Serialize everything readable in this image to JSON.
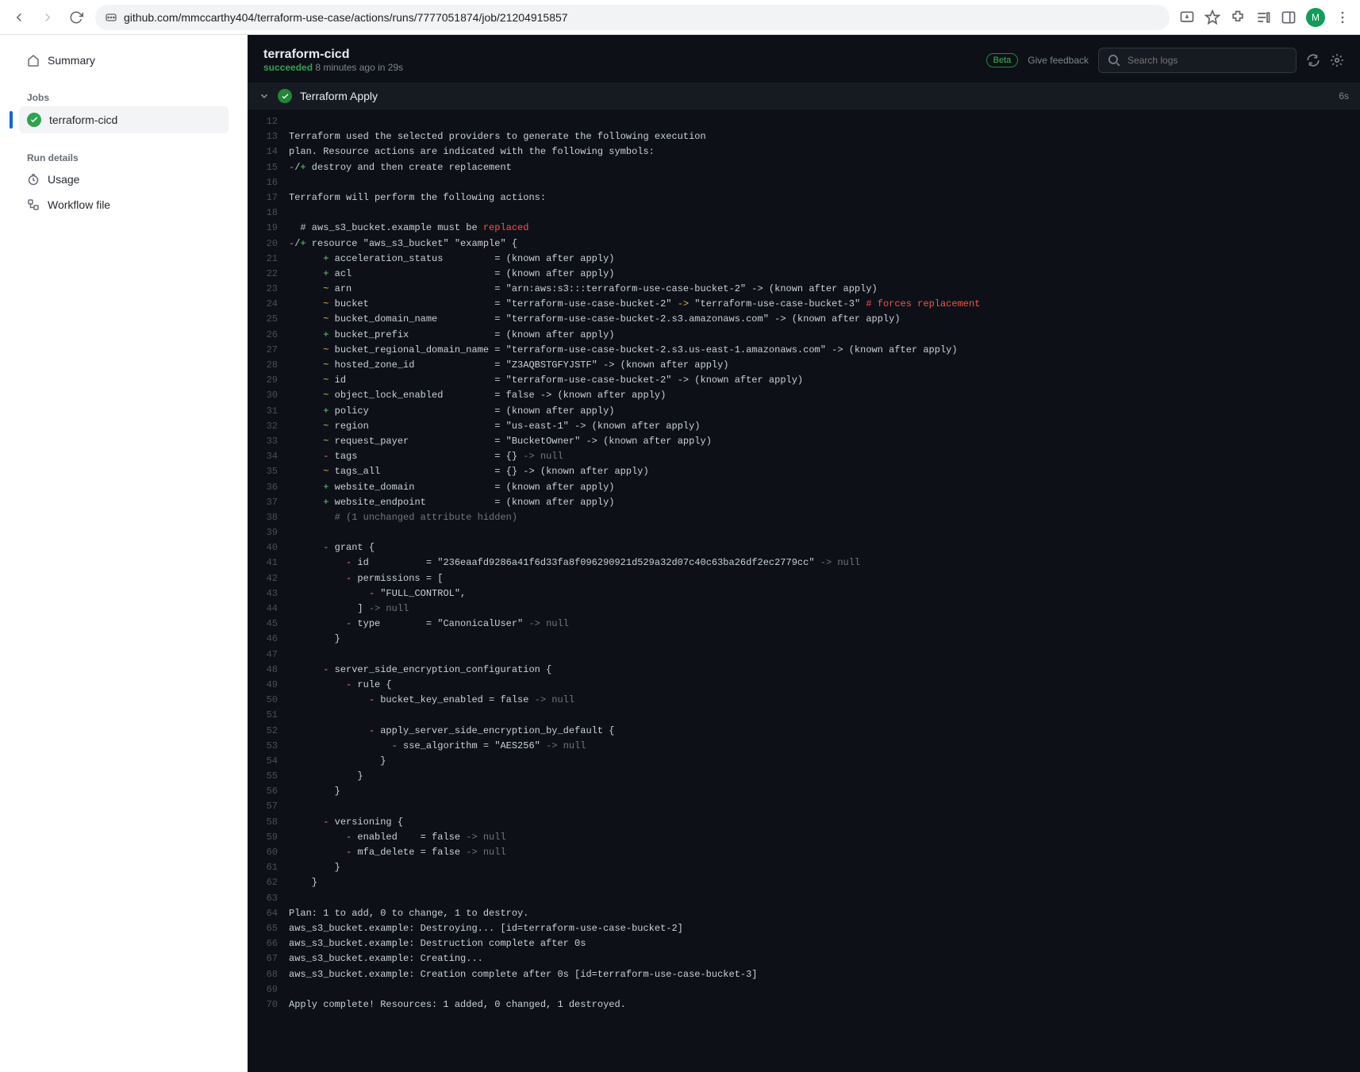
{
  "browser": {
    "url": "github.com/mmccarthy404/terraform-use-case/actions/runs/7777051874/job/21204915857",
    "avatar_letter": "M"
  },
  "sidebar": {
    "summary": "Summary",
    "jobs_heading": "Jobs",
    "job": "terraform-cicd",
    "run_details_heading": "Run details",
    "usage": "Usage",
    "workflow_file": "Workflow file"
  },
  "header": {
    "title": "terraform-cicd",
    "status": "succeeded",
    "meta_rest": " 8 minutes ago in 29s",
    "beta": "Beta",
    "feedback": "Give feedback",
    "search_placeholder": "Search logs"
  },
  "step": {
    "name": "Terraform Apply",
    "duration": "6s"
  },
  "log_lines": [
    {
      "n": 12,
      "segs": []
    },
    {
      "n": 13,
      "segs": [
        {
          "t": "Terraform used the selected providers to generate the following execution"
        }
      ]
    },
    {
      "n": 14,
      "segs": [
        {
          "t": "plan. Resource actions are indicated with the following symbols:"
        }
      ]
    },
    {
      "n": 15,
      "segs": [
        {
          "c": "c-red",
          "t": "-"
        },
        {
          "t": "/"
        },
        {
          "c": "c-green",
          "t": "+"
        },
        {
          "t": " destroy and then create replacement"
        }
      ]
    },
    {
      "n": 16,
      "segs": []
    },
    {
      "n": 17,
      "segs": [
        {
          "t": "Terraform will perform the following actions:"
        }
      ]
    },
    {
      "n": 18,
      "segs": []
    },
    {
      "n": 19,
      "segs": [
        {
          "t": "  # aws_s3_bucket.example must be "
        },
        {
          "c": "c-redcom",
          "t": "replaced"
        }
      ]
    },
    {
      "n": 20,
      "segs": [
        {
          "c": "c-red",
          "t": "-"
        },
        {
          "t": "/"
        },
        {
          "c": "c-green",
          "t": "+"
        },
        {
          "t": " resource \"aws_s3_bucket\" \"example\" {"
        }
      ]
    },
    {
      "n": 21,
      "segs": [
        {
          "t": "      "
        },
        {
          "c": "c-green",
          "t": "+"
        },
        {
          "t": " acceleration_status         = (known after apply)"
        }
      ]
    },
    {
      "n": 22,
      "segs": [
        {
          "t": "      "
        },
        {
          "c": "c-green",
          "t": "+"
        },
        {
          "t": " acl                         = (known after apply)"
        }
      ]
    },
    {
      "n": 23,
      "segs": [
        {
          "t": "      "
        },
        {
          "c": "c-orange",
          "t": "~"
        },
        {
          "t": " arn                         = \"arn:aws:s3:::terraform-use-case-bucket-2\" -> (known after apply)"
        }
      ]
    },
    {
      "n": 24,
      "segs": [
        {
          "t": "      "
        },
        {
          "c": "c-orange",
          "t": "~"
        },
        {
          "t": " bucket                      = \"terraform-use-case-bucket-2\" "
        },
        {
          "c": "c-orange",
          "t": "->"
        },
        {
          "t": " \"terraform-use-case-bucket-3\" "
        },
        {
          "c": "c-redcom",
          "t": "# forces replacement"
        }
      ]
    },
    {
      "n": 25,
      "segs": [
        {
          "t": "      "
        },
        {
          "c": "c-orange",
          "t": "~"
        },
        {
          "t": " bucket_domain_name          = \"terraform-use-case-bucket-2.s3.amazonaws.com\" -> (known after apply)"
        }
      ]
    },
    {
      "n": 26,
      "segs": [
        {
          "t": "      "
        },
        {
          "c": "c-green",
          "t": "+"
        },
        {
          "t": " bucket_prefix               = (known after apply)"
        }
      ]
    },
    {
      "n": 27,
      "segs": [
        {
          "t": "      "
        },
        {
          "c": "c-orange",
          "t": "~"
        },
        {
          "t": " bucket_regional_domain_name = \"terraform-use-case-bucket-2.s3.us-east-1.amazonaws.com\" -> (known after apply)"
        }
      ]
    },
    {
      "n": 28,
      "segs": [
        {
          "t": "      "
        },
        {
          "c": "c-orange",
          "t": "~"
        },
        {
          "t": " hosted_zone_id              = \"Z3AQBSTGFYJSTF\" -> (known after apply)"
        }
      ]
    },
    {
      "n": 29,
      "segs": [
        {
          "t": "      "
        },
        {
          "c": "c-orange",
          "t": "~"
        },
        {
          "t": " id                          = \"terraform-use-case-bucket-2\" -> (known after apply)"
        }
      ]
    },
    {
      "n": 30,
      "segs": [
        {
          "t": "      "
        },
        {
          "c": "c-orange",
          "t": "~"
        },
        {
          "t": " object_lock_enabled         = false -> (known after apply)"
        }
      ]
    },
    {
      "n": 31,
      "segs": [
        {
          "t": "      "
        },
        {
          "c": "c-green",
          "t": "+"
        },
        {
          "t": " policy                      = (known after apply)"
        }
      ]
    },
    {
      "n": 32,
      "segs": [
        {
          "t": "      "
        },
        {
          "c": "c-orange",
          "t": "~"
        },
        {
          "t": " region                      = \"us-east-1\" -> (known after apply)"
        }
      ]
    },
    {
      "n": 33,
      "segs": [
        {
          "t": "      "
        },
        {
          "c": "c-orange",
          "t": "~"
        },
        {
          "t": " request_payer               = \"BucketOwner\" -> (known after apply)"
        }
      ]
    },
    {
      "n": 34,
      "segs": [
        {
          "t": "      "
        },
        {
          "c": "c-red",
          "t": "-"
        },
        {
          "t": " tags                        = {} "
        },
        {
          "c": "c-null",
          "t": "-> null"
        }
      ]
    },
    {
      "n": 35,
      "segs": [
        {
          "t": "      "
        },
        {
          "c": "c-orange",
          "t": "~"
        },
        {
          "t": " tags_all                    = {} -> (known after apply)"
        }
      ]
    },
    {
      "n": 36,
      "segs": [
        {
          "t": "      "
        },
        {
          "c": "c-green",
          "t": "+"
        },
        {
          "t": " website_domain              = (known after apply)"
        }
      ]
    },
    {
      "n": 37,
      "segs": [
        {
          "t": "      "
        },
        {
          "c": "c-green",
          "t": "+"
        },
        {
          "t": " website_endpoint            = (known after apply)"
        }
      ]
    },
    {
      "n": 38,
      "segs": [
        {
          "t": "        "
        },
        {
          "c": "c-null",
          "t": "# (1 unchanged attribute hidden)"
        }
      ]
    },
    {
      "n": 39,
      "segs": []
    },
    {
      "n": 40,
      "segs": [
        {
          "t": "      "
        },
        {
          "c": "c-red",
          "t": "-"
        },
        {
          "t": " grant {"
        }
      ]
    },
    {
      "n": 41,
      "segs": [
        {
          "t": "          "
        },
        {
          "c": "c-red",
          "t": "-"
        },
        {
          "t": " id          = \"236eaafd9286a41f6d33fa8f096290921d529a32d07c40c63ba26df2ec2779cc\" "
        },
        {
          "c": "c-null",
          "t": "-> null"
        }
      ]
    },
    {
      "n": 42,
      "segs": [
        {
          "t": "          "
        },
        {
          "c": "c-red",
          "t": "-"
        },
        {
          "t": " permissions = ["
        }
      ]
    },
    {
      "n": 43,
      "segs": [
        {
          "t": "              "
        },
        {
          "c": "c-red",
          "t": "-"
        },
        {
          "t": " \"FULL_CONTROL\","
        }
      ]
    },
    {
      "n": 44,
      "segs": [
        {
          "t": "            ] "
        },
        {
          "c": "c-null",
          "t": "-> null"
        }
      ]
    },
    {
      "n": 45,
      "segs": [
        {
          "t": "          "
        },
        {
          "c": "c-red",
          "t": "-"
        },
        {
          "t": " type        = \"CanonicalUser\" "
        },
        {
          "c": "c-null",
          "t": "-> null"
        }
      ]
    },
    {
      "n": 46,
      "segs": [
        {
          "t": "        }"
        }
      ]
    },
    {
      "n": 47,
      "segs": []
    },
    {
      "n": 48,
      "segs": [
        {
          "t": "      "
        },
        {
          "c": "c-red",
          "t": "-"
        },
        {
          "t": " server_side_encryption_configuration {"
        }
      ]
    },
    {
      "n": 49,
      "segs": [
        {
          "t": "          "
        },
        {
          "c": "c-red",
          "t": "-"
        },
        {
          "t": " rule {"
        }
      ]
    },
    {
      "n": 50,
      "segs": [
        {
          "t": "              "
        },
        {
          "c": "c-red",
          "t": "-"
        },
        {
          "t": " bucket_key_enabled = false "
        },
        {
          "c": "c-null",
          "t": "-> null"
        }
      ]
    },
    {
      "n": 51,
      "segs": []
    },
    {
      "n": 52,
      "segs": [
        {
          "t": "              "
        },
        {
          "c": "c-red",
          "t": "-"
        },
        {
          "t": " apply_server_side_encryption_by_default {"
        }
      ]
    },
    {
      "n": 53,
      "segs": [
        {
          "t": "                  "
        },
        {
          "c": "c-red",
          "t": "-"
        },
        {
          "t": " sse_algorithm = \"AES256\" "
        },
        {
          "c": "c-null",
          "t": "-> null"
        }
      ]
    },
    {
      "n": 54,
      "segs": [
        {
          "t": "                }"
        }
      ]
    },
    {
      "n": 55,
      "segs": [
        {
          "t": "            }"
        }
      ]
    },
    {
      "n": 56,
      "segs": [
        {
          "t": "        }"
        }
      ]
    },
    {
      "n": 57,
      "segs": []
    },
    {
      "n": 58,
      "segs": [
        {
          "t": "      "
        },
        {
          "c": "c-red",
          "t": "-"
        },
        {
          "t": " versioning {"
        }
      ]
    },
    {
      "n": 59,
      "segs": [
        {
          "t": "          "
        },
        {
          "c": "c-red",
          "t": "-"
        },
        {
          "t": " enabled    = false "
        },
        {
          "c": "c-null",
          "t": "-> null"
        }
      ]
    },
    {
      "n": 60,
      "segs": [
        {
          "t": "          "
        },
        {
          "c": "c-red",
          "t": "-"
        },
        {
          "t": " mfa_delete = false "
        },
        {
          "c": "c-null",
          "t": "-> null"
        }
      ]
    },
    {
      "n": 61,
      "segs": [
        {
          "t": "        }"
        }
      ]
    },
    {
      "n": 62,
      "segs": [
        {
          "t": "    }"
        }
      ]
    },
    {
      "n": 63,
      "segs": []
    },
    {
      "n": 64,
      "segs": [
        {
          "t": "Plan: 1 to add, 0 to change, 1 to destroy."
        }
      ]
    },
    {
      "n": 65,
      "segs": [
        {
          "t": "aws_s3_bucket.example: Destroying... [id=terraform-use-case-bucket-2]"
        }
      ]
    },
    {
      "n": 66,
      "segs": [
        {
          "t": "aws_s3_bucket.example: Destruction complete after 0s"
        }
      ]
    },
    {
      "n": 67,
      "segs": [
        {
          "t": "aws_s3_bucket.example: Creating..."
        }
      ]
    },
    {
      "n": 68,
      "segs": [
        {
          "t": "aws_s3_bucket.example: Creation complete after 0s [id=terraform-use-case-bucket-3]"
        }
      ]
    },
    {
      "n": 69,
      "segs": []
    },
    {
      "n": 70,
      "segs": [
        {
          "t": "Apply complete! Resources: 1 added, 0 changed, 1 destroyed."
        }
      ]
    }
  ]
}
